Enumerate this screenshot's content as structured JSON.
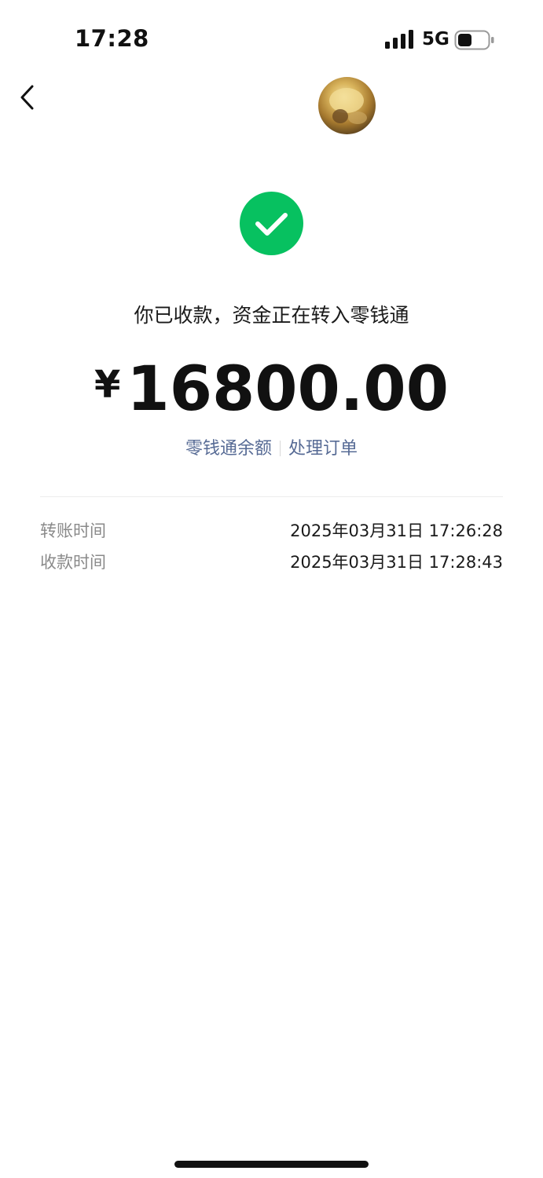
{
  "status_bar": {
    "time": "17:28",
    "network": "5G",
    "signal_icon": "signal-bars-icon",
    "battery_icon": "battery-icon"
  },
  "header": {
    "back_icon": "chevron-left-icon",
    "avatar": "user-avatar"
  },
  "result": {
    "icon": "checkmark-circle-icon",
    "icon_color": "#07c160",
    "message": "你已收款，资金正在转入零钱通",
    "currency": "¥",
    "amount": "16800.00"
  },
  "links": {
    "balance_label": "零钱通余额",
    "order_label": "处理订单",
    "link_color": "#576b95"
  },
  "details": [
    {
      "label": "转账时间",
      "value": "2025年03月31日 17:26:28"
    },
    {
      "label": "收款时间",
      "value": "2025年03月31日 17:28:43"
    }
  ]
}
